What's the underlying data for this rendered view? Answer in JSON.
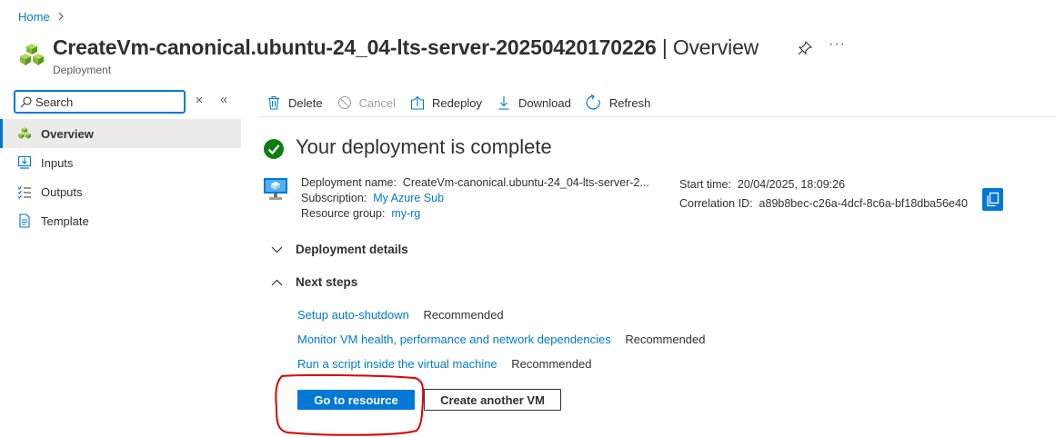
{
  "breadcrumb": {
    "home": "Home"
  },
  "header": {
    "title": "CreateVm-canonical.ubuntu-24_04-lts-server-20250420170226",
    "separator": "|",
    "section": "Overview",
    "subtitle": "Deployment",
    "more": "···"
  },
  "sidebar": {
    "search_placeholder": "Search",
    "items": [
      {
        "label": "Overview",
        "icon": "deployment-cubes-icon",
        "active": true
      },
      {
        "label": "Inputs",
        "icon": "inputs-icon"
      },
      {
        "label": "Outputs",
        "icon": "outputs-list-icon"
      },
      {
        "label": "Template",
        "icon": "template-doc-icon"
      }
    ]
  },
  "toolbar": {
    "delete": "Delete",
    "cancel": "Cancel",
    "redeploy": "Redeploy",
    "download": "Download",
    "refresh": "Refresh"
  },
  "status": {
    "title": "Your deployment is complete",
    "deployment_name_label": "Deployment name:",
    "deployment_name": "CreateVm-canonical.ubuntu-24_04-lts-server-2...",
    "subscription_label": "Subscription:",
    "subscription": "My Azure Sub",
    "resource_group_label": "Resource group:",
    "resource_group": "my-rg",
    "start_time_label": "Start time:",
    "start_time": "20/04/2025, 18:09:26",
    "correlation_label": "Correlation ID:",
    "correlation_id": "a89b8bec-c26a-4dcf-8c6a-bf18dba56e40"
  },
  "sections": {
    "deployment_details": "Deployment details",
    "next_steps": "Next steps"
  },
  "next_steps": [
    {
      "link": "Setup auto-shutdown",
      "tag": "Recommended"
    },
    {
      "link": "Monitor VM health, performance and network dependencies",
      "tag": "Recommended"
    },
    {
      "link": "Run a script inside the virtual machine",
      "tag": "Recommended"
    }
  ],
  "actions": {
    "primary": "Go to resource",
    "secondary": "Create another VM"
  },
  "colors": {
    "accent": "#0078d4",
    "success": "#107c10",
    "annotation": "#e00000"
  }
}
